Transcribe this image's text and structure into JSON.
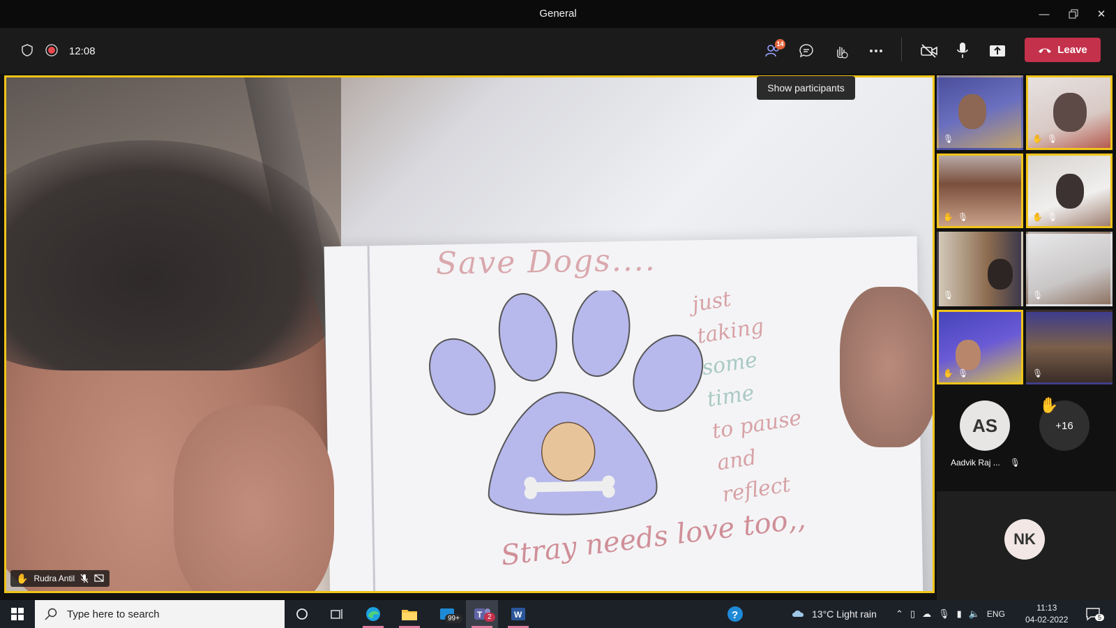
{
  "window": {
    "title": "General"
  },
  "toolbar": {
    "meeting_time": "12:08",
    "participants_count": "14",
    "leave_label": "Leave",
    "tooltip": "Show participants"
  },
  "stage": {
    "speaker_name": "Rudra Antil",
    "paper_title": "Save Dogs....",
    "paper_footer": "Stray needs love too,,",
    "paper_side_lines": [
      "just",
      "taking",
      "some",
      "time",
      "to pause",
      "and",
      "reflect"
    ]
  },
  "gallery": {
    "avatar_as": {
      "initials": "AS",
      "name": "Aadvik Raj ..."
    },
    "overflow": {
      "label": "+16"
    },
    "avatar_nk": {
      "initials": "NK"
    }
  },
  "taskbar": {
    "search_placeholder": "Type here to search",
    "mail_badge": "99+",
    "teams_badge": "2",
    "weather": "13°C  Light rain",
    "language": "ENG",
    "time": "11:13",
    "date": "04-02-2022",
    "notifications": "5"
  },
  "colors": {
    "accent_raised_hand": "#f0c419",
    "leave": "#c4314b",
    "badge": "#e4643c"
  }
}
